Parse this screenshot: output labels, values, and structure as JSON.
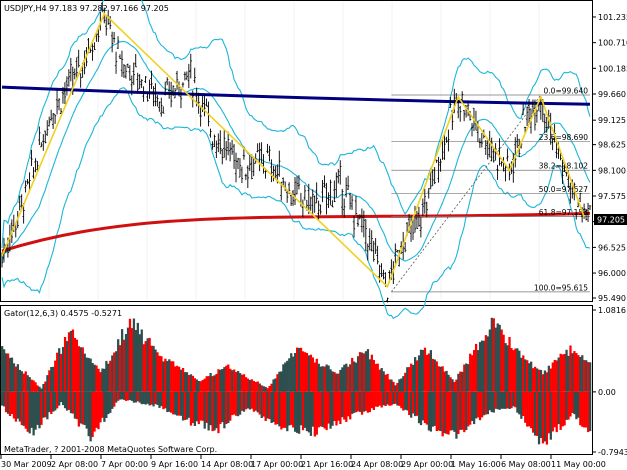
{
  "main_chart": {
    "header": "USDJPY,H4  97.183 97.282 97.166 97.205",
    "current_price": "97.205",
    "price_ticks": [
      "101.235",
      "100.710",
      "100.185",
      "99.660",
      "99.125",
      "98.625",
      "98.100",
      "97.575",
      "97.050",
      "96.525",
      "96.000",
      "95.490"
    ],
    "price_range": [
      95.49,
      101.5
    ],
    "fibo_levels": [
      {
        "label": "0.0=99.640",
        "value": 99.64
      },
      {
        "label": "23.6=98.690",
        "value": 98.69
      },
      {
        "label": "38.2=98.102",
        "value": 98.102
      },
      {
        "label": "50.0=97.627",
        "value": 97.627
      },
      {
        "label": "61.8=97.153",
        "value": 97.153
      },
      {
        "label": "100.0=95.615",
        "value": 95.615
      }
    ]
  },
  "gator": {
    "header": "Gator(12,6,3)  0.4575  -0.5271",
    "ticks": [
      "1.0816",
      "0.00",
      "-0.7943"
    ],
    "range": [
      -0.7943,
      1.0816
    ],
    "colors": {
      "up": "#ff0000",
      "down": "#2f4f4f"
    }
  },
  "time_axis": [
    "30 Mar 2009",
    "2 Apr 08:00",
    "7 Apr 00:00",
    "9 Apr 16:00",
    "14 Apr 08:00",
    "17 Apr 00:00",
    "21 Apr 16:00",
    "24 Apr 08:00",
    "29 Apr 00:00",
    "1 May 16:00",
    "6 May 08:00",
    "11 May 00:00"
  ],
  "copyright": "MetaTrader, ? 2001-2008 MetaQuotes Software Corp.",
  "colors": {
    "candles": "#000000",
    "bollinger": "#1cb6d8",
    "long_ma": "#000080",
    "ma_200": "#d01010",
    "zigzag": "#f0d020",
    "price_tag_bg": "#000000",
    "price_tag_text": "#ffffff"
  }
}
